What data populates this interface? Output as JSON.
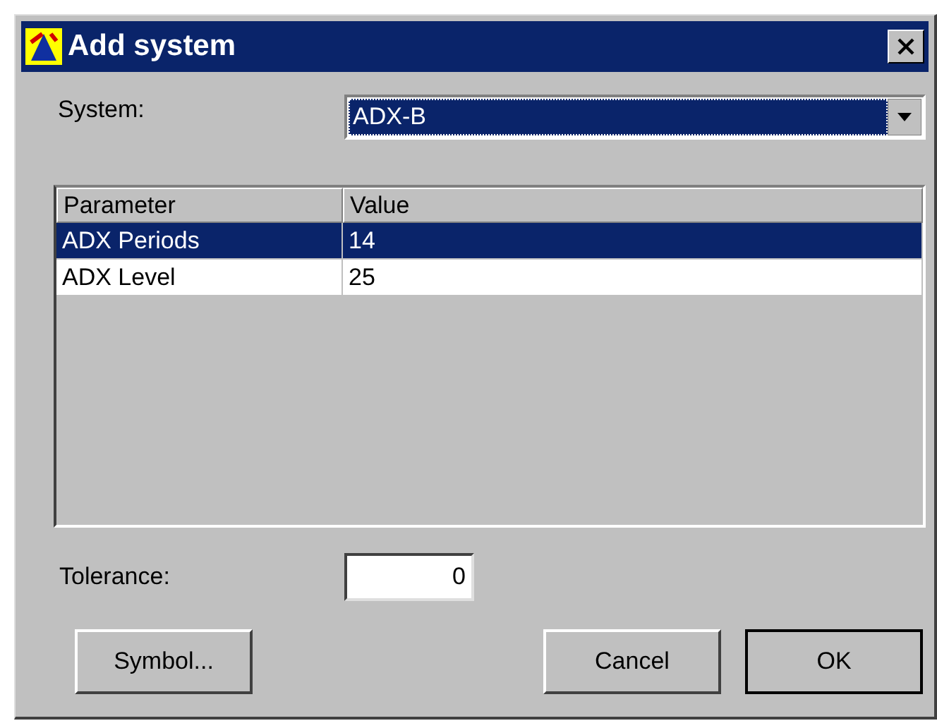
{
  "window": {
    "title": "Add system"
  },
  "system": {
    "label": "System:",
    "value": "ADX-B"
  },
  "table": {
    "columns": [
      "Parameter",
      "Value"
    ],
    "rows": [
      {
        "cells": [
          "ADX Periods",
          "14"
        ],
        "selected": true
      },
      {
        "cells": [
          "ADX Level",
          "25"
        ],
        "selected": false
      }
    ]
  },
  "tolerance": {
    "label": "Tolerance:",
    "value": "0"
  },
  "buttons": [
    {
      "label": "Symbol...",
      "default": false
    },
    {
      "label": "Cancel",
      "default": false
    },
    {
      "label": "OK",
      "default": true
    }
  ]
}
